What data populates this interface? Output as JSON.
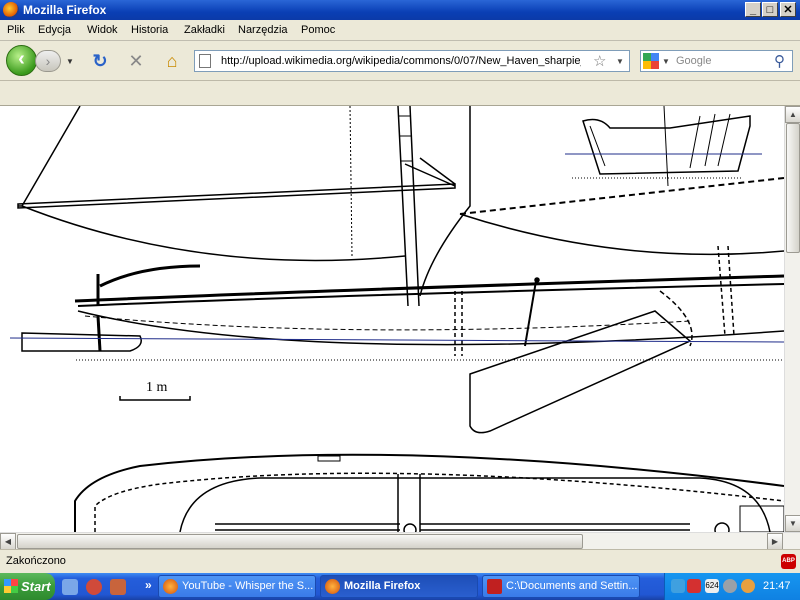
{
  "window": {
    "title": "Mozilla Firefox",
    "controls": {
      "minimize": "_",
      "maximize": "□",
      "close": "✕"
    }
  },
  "menu": [
    "Plik",
    "Edycja",
    "Widok",
    "Historia",
    "Zakładki",
    "Narzędzia",
    "Pomoc"
  ],
  "nav": {
    "url": "http://upload.wikimedia.org/wikipedia/commons/0/07/New_Haven_sharpie_",
    "search_placeholder": "Google"
  },
  "drawing": {
    "scale_label": "1 m"
  },
  "status": {
    "text": "Zakończono"
  },
  "taskbar": {
    "start_label": "Start",
    "tasks": [
      {
        "label": "YouTube - Whisper the S...",
        "active": false
      },
      {
        "label": "Mozilla Firefox",
        "active": true
      },
      {
        "label": "C:\\Documents and Settin...",
        "active": false
      }
    ],
    "tray_badge": "624",
    "clock": "21:47"
  }
}
